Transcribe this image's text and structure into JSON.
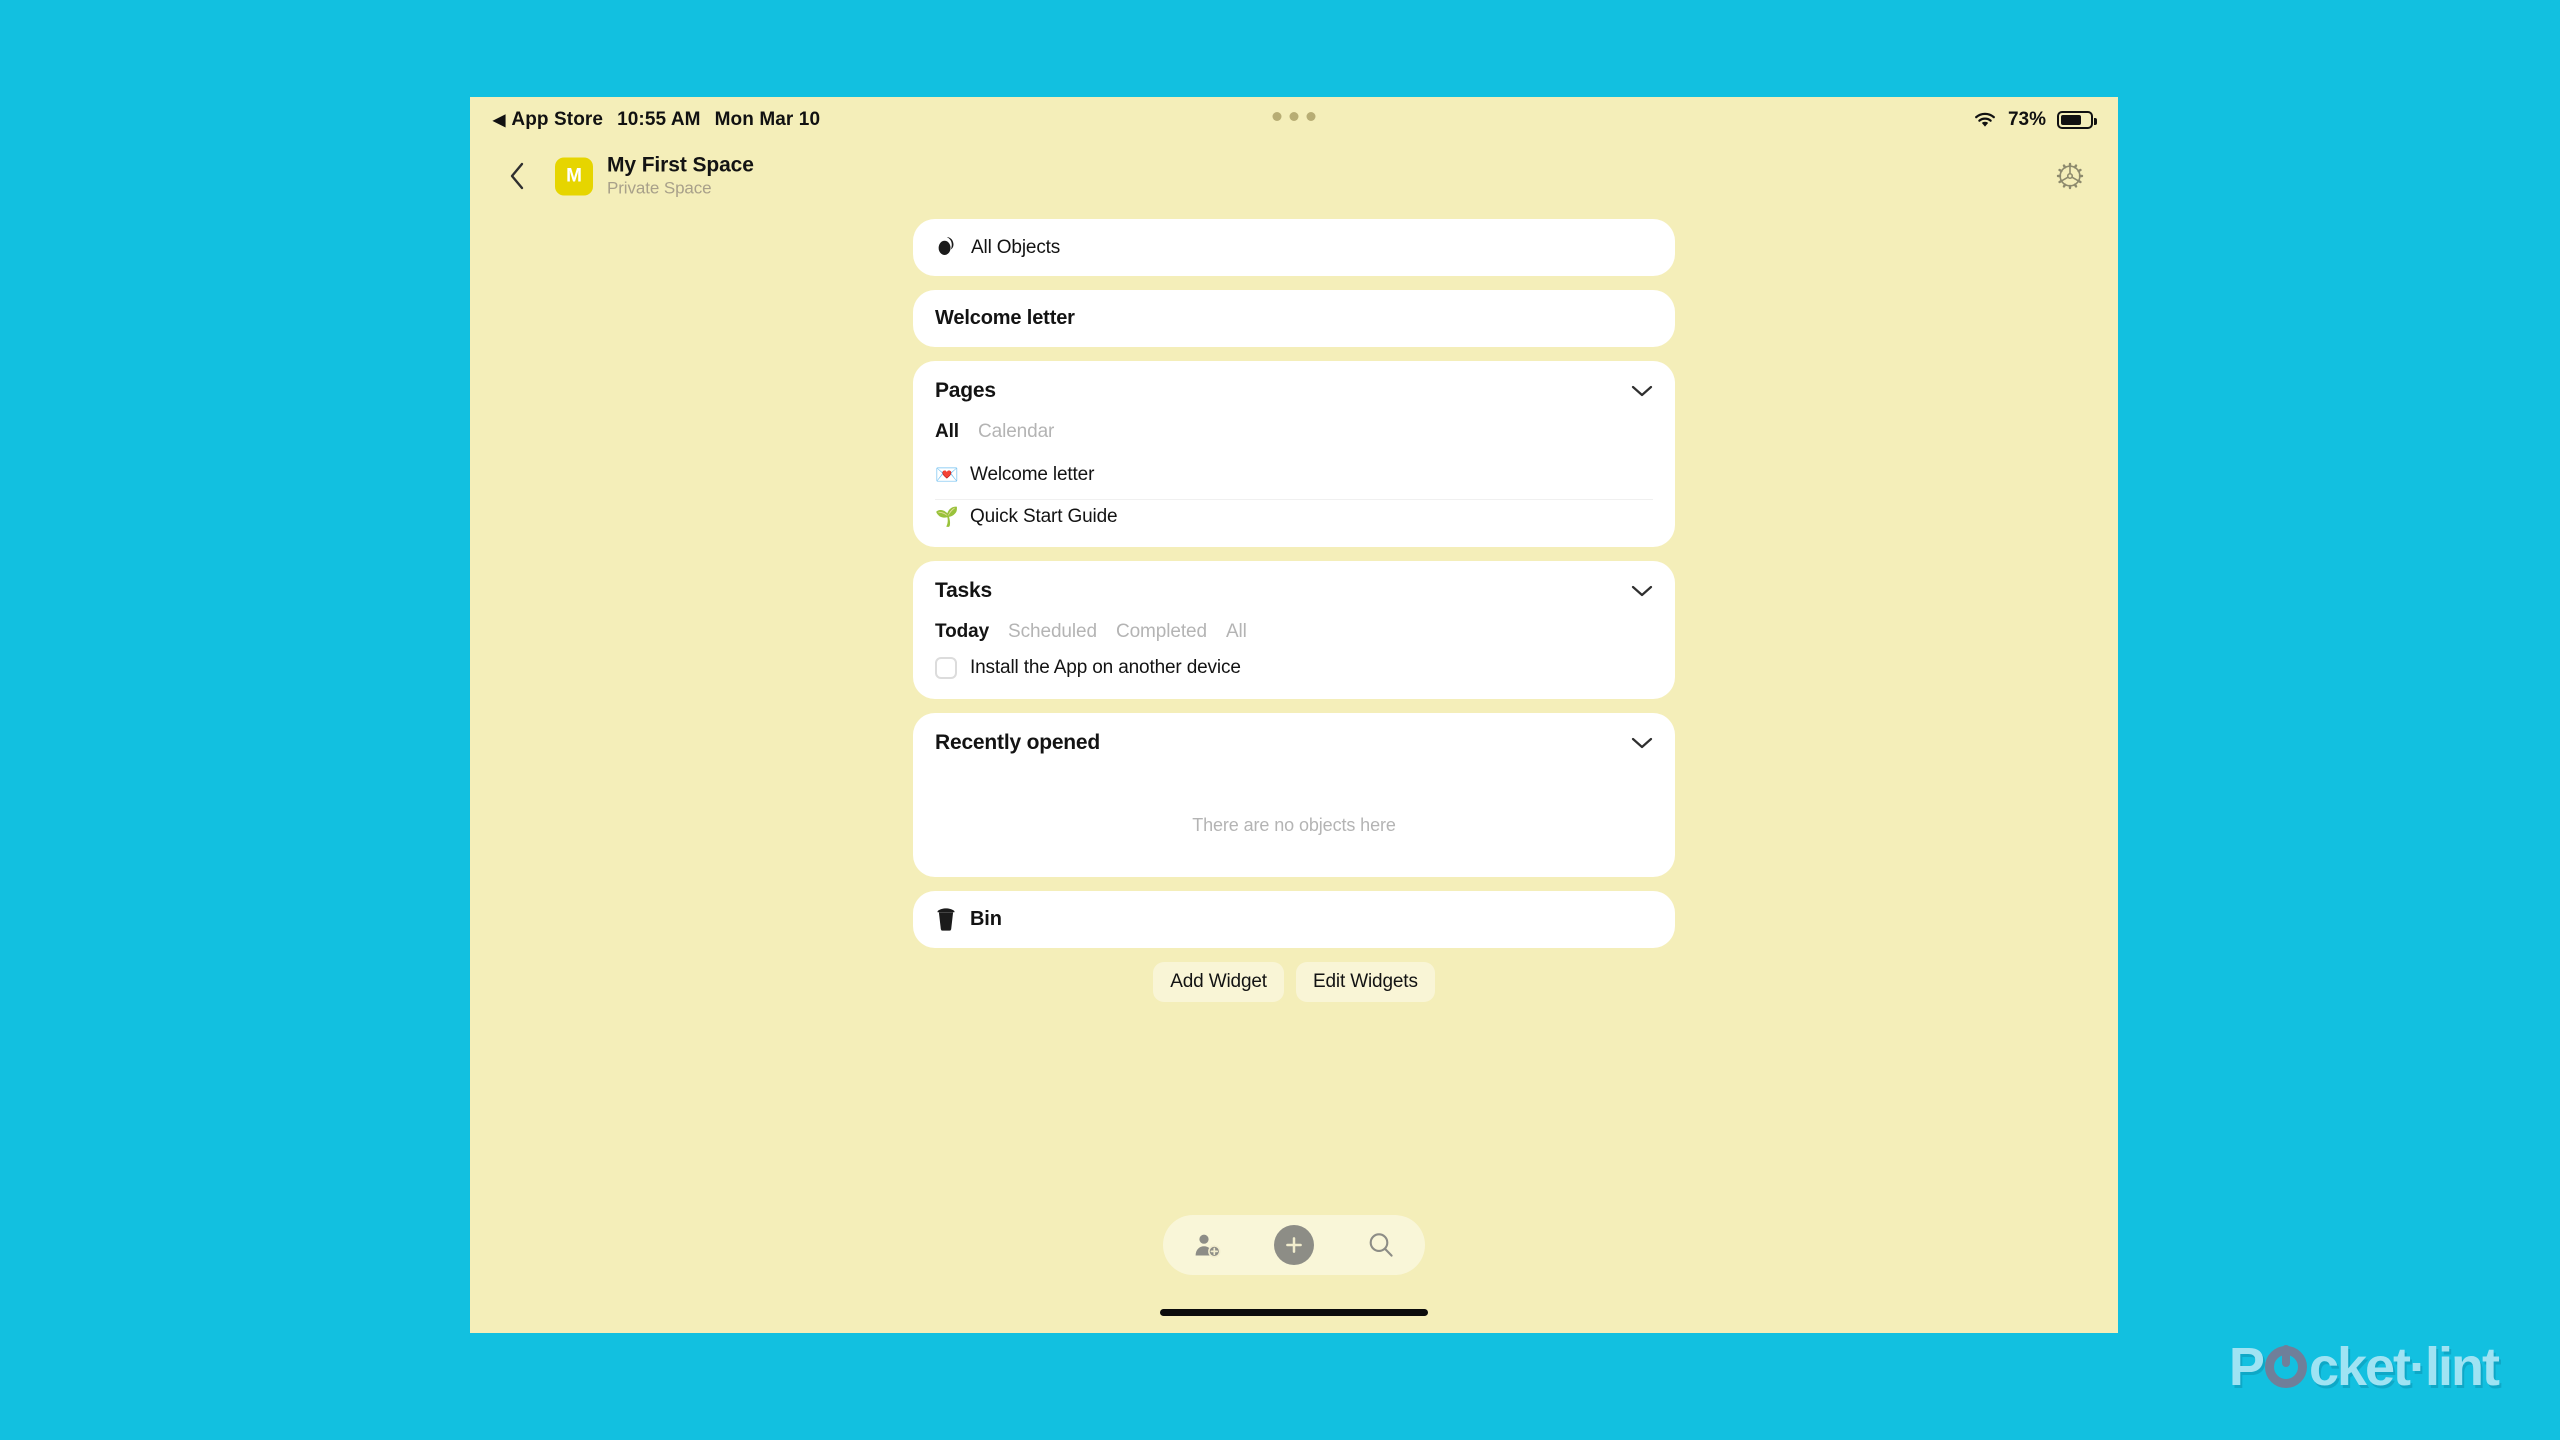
{
  "theme": {
    "page_bg": "#12c0e0",
    "device_bg": "#f4eeb9",
    "widget_bg": "#ffffff",
    "accent_avatar": "#e6d500",
    "text_primary": "#131313",
    "text_muted": "#b4b4b4"
  },
  "status_bar": {
    "back_arrow": "◀",
    "back_app": "App Store",
    "time": "10:55 AM",
    "date": "Mon Mar 10",
    "wifi_icon": "wifi-icon",
    "battery_percent": "73%",
    "multitask_dots": "⋯"
  },
  "header": {
    "back_icon": "chevron-left-icon",
    "avatar_letter": "M",
    "space_title": "My First Space",
    "space_subtitle": "Private Space",
    "settings_icon": "gear-icon"
  },
  "widgets": [
    {
      "id": "all-objects",
      "type": "link",
      "icon": "anytype-logo-icon",
      "label": "All Objects"
    },
    {
      "id": "welcome-letter",
      "type": "link",
      "label": "Welcome letter"
    },
    {
      "id": "pages",
      "type": "list",
      "title": "Pages",
      "collapse_icon": "chevron-down-icon",
      "tabs": [
        {
          "label": "All",
          "active": true
        },
        {
          "label": "Calendar",
          "active": false
        }
      ],
      "items": [
        {
          "emoji": "💌",
          "emoji_name": "love-letter-emoji",
          "label": "Welcome letter"
        },
        {
          "emoji": "🌱",
          "emoji_name": "seedling-emoji",
          "label": "Quick Start Guide"
        }
      ]
    },
    {
      "id": "tasks",
      "type": "tasks",
      "title": "Tasks",
      "collapse_icon": "chevron-down-icon",
      "tabs": [
        {
          "label": "Today",
          "active": true
        },
        {
          "label": "Scheduled",
          "active": false
        },
        {
          "label": "Completed",
          "active": false
        },
        {
          "label": "All",
          "active": false
        }
      ],
      "items": [
        {
          "checked": false,
          "label": "Install the App on another device"
        }
      ]
    },
    {
      "id": "recently-opened",
      "type": "empty",
      "title": "Recently opened",
      "collapse_icon": "chevron-down-icon",
      "empty_text": "There are no objects here"
    },
    {
      "id": "bin",
      "type": "link",
      "icon": "trash-bin-icon",
      "label": "Bin"
    }
  ],
  "widget_actions": {
    "add_label": "Add Widget",
    "edit_label": "Edit Widgets"
  },
  "bottom_bar": {
    "members_icon": "add-member-icon",
    "create_icon": "plus-icon",
    "search_icon": "search-icon"
  },
  "watermark": {
    "text_before": "P",
    "text_after": "cket·lint"
  }
}
